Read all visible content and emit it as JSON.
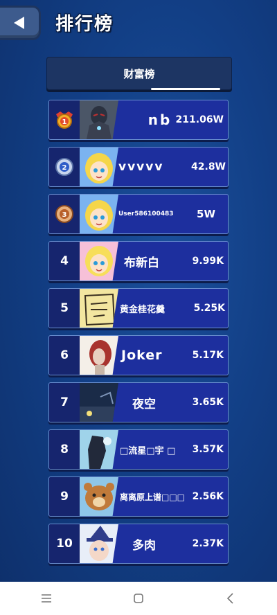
{
  "header": {
    "title": "排行榜",
    "back_icon": "back-arrow-icon"
  },
  "tabs": [
    {
      "label": "财富榜",
      "active": true
    }
  ],
  "colors": {
    "background": "#123f86",
    "row": "#1d2f9e",
    "rank_cell": "#16256e",
    "gold": "#e6a020",
    "silver": "#9fb4d8",
    "bronze": "#c77a3a"
  },
  "ranking": [
    {
      "rank": "1",
      "medal": "gold-medal-icon",
      "avatar": "armored-hero-avatar",
      "name": "nb",
      "score": "211.06W"
    },
    {
      "rank": "2",
      "medal": "silver-medal-icon",
      "avatar": "blonde-girl-avatar",
      "name": "vvvvv",
      "score": "42.8W"
    },
    {
      "rank": "3",
      "medal": "bronze-medal-icon",
      "avatar": "blonde-girl-avatar",
      "name": "User586100483",
      "score": "5W"
    },
    {
      "rank": "4",
      "avatar": "cartoon-girl-avatar",
      "name": "布新白",
      "score": "9.99K"
    },
    {
      "rank": "5",
      "avatar": "sketch-avatar",
      "name": "黄金桂花羹",
      "score": "5.25K"
    },
    {
      "rank": "6",
      "avatar": "red-hair-avatar",
      "name": "Joker",
      "score": "5.17K"
    },
    {
      "rank": "7",
      "avatar": "night-scene-avatar",
      "name": "夜空",
      "score": "3.65K"
    },
    {
      "rank": "8",
      "avatar": "dark-figure-avatar",
      "name": "□流星□宇 □",
      "score": "3.57K"
    },
    {
      "rank": "9",
      "avatar": "bear-avatar",
      "name": "离离原上谱□□□",
      "score": "2.56K"
    },
    {
      "rank": "10",
      "avatar": "witch-avatar",
      "name": "多肉",
      "score": "2.37K"
    }
  ],
  "navbar": {
    "menu_icon": "menu-icon",
    "home_icon": "home-icon",
    "back_icon": "back-icon"
  }
}
